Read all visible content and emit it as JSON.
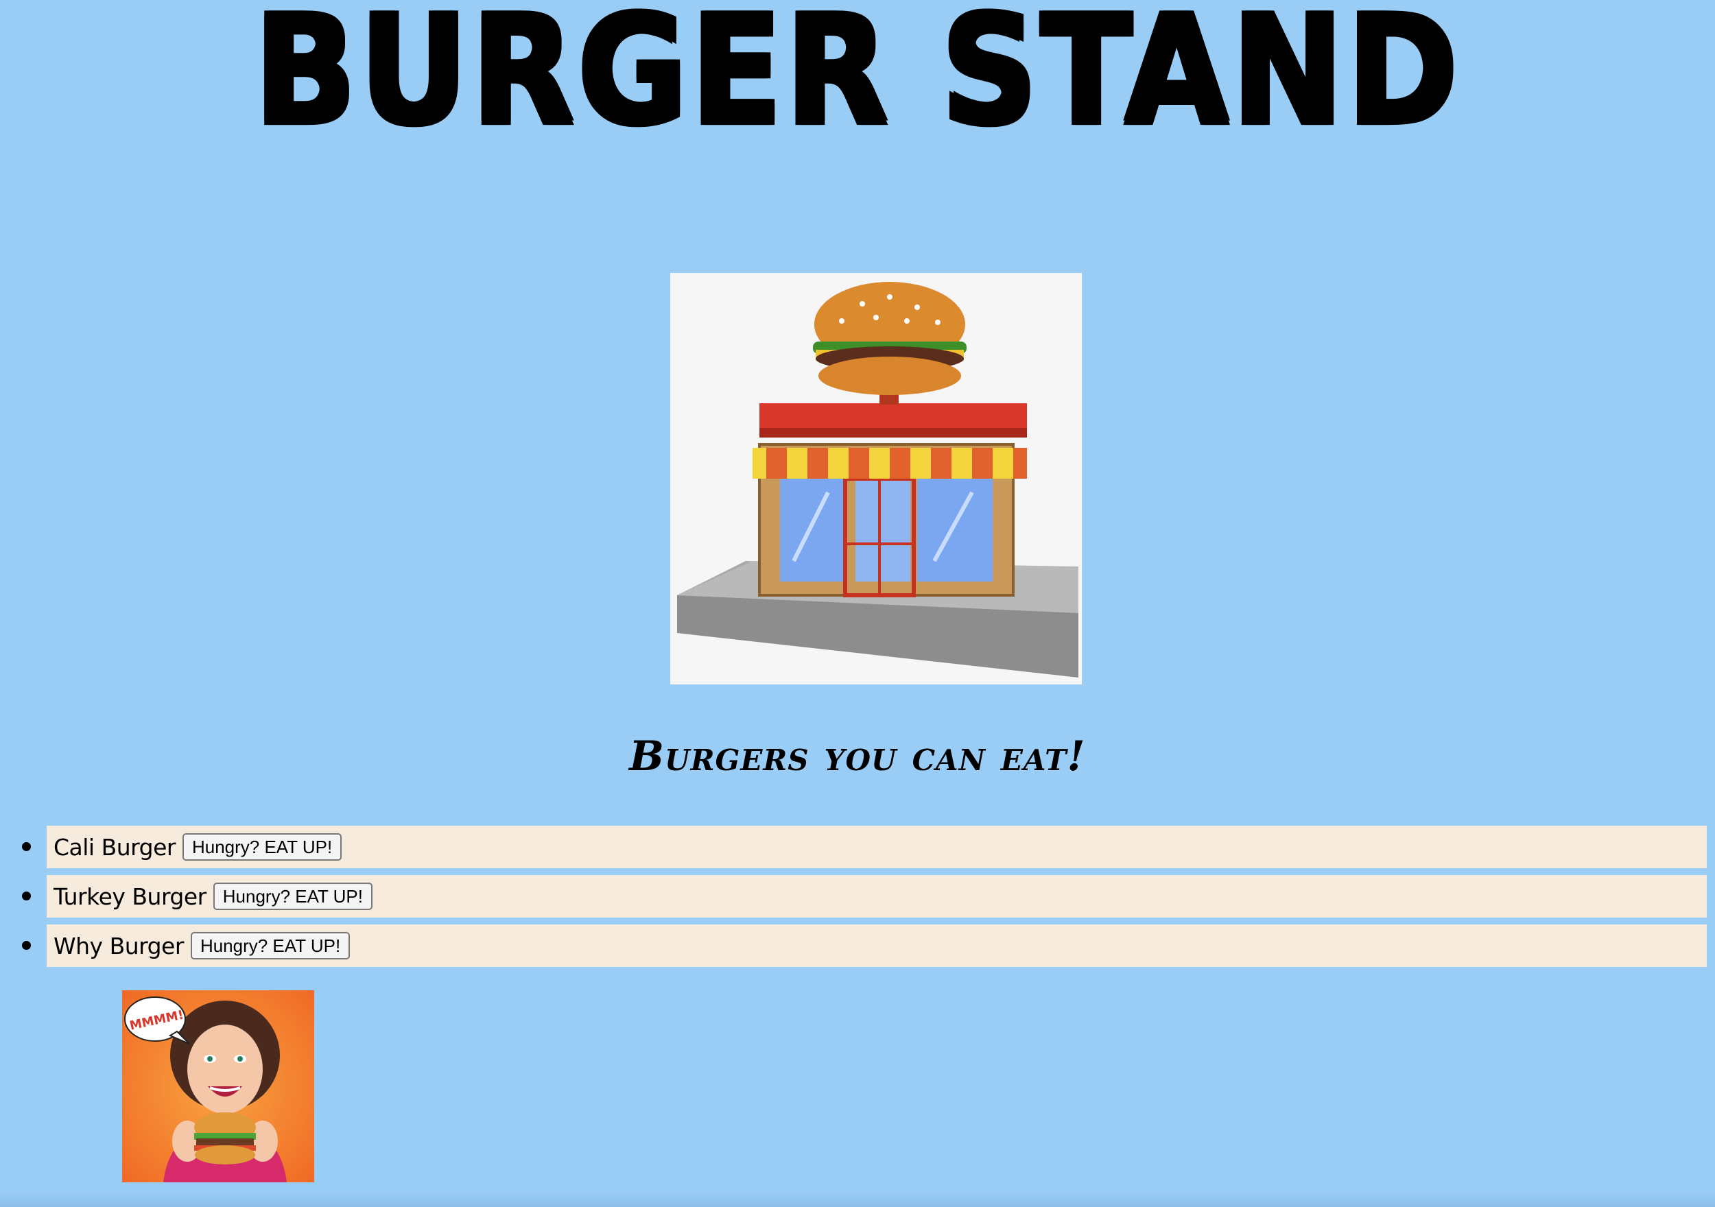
{
  "page": {
    "title": "BURGER STAND",
    "subtitle": "Burgers you can eat!"
  },
  "menu": {
    "items": [
      {
        "name": "Cali Burger",
        "button_label": "Hungry? EAT UP!"
      },
      {
        "name": "Turkey Burger",
        "button_label": "Hungry? EAT UP!"
      },
      {
        "name": "Why Burger",
        "button_label": "Hungry? EAT UP!"
      }
    ]
  },
  "images": {
    "hero": "burger-stand-building-image",
    "promo": "woman-eating-burger-image",
    "promo_bubble_text": "MMMM!"
  },
  "colors": {
    "background": "#9acdf6",
    "item_background": "#f6ebdc",
    "awning_red": "#d8372a",
    "awning_yellow": "#f4d43c"
  }
}
